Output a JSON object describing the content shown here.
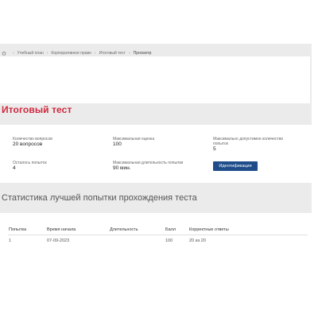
{
  "breadcrumb": {
    "home_icon": "home-icon",
    "items": [
      "Учебный план",
      "Корпоративное право",
      "Итоговый тест",
      "Просмотр"
    ]
  },
  "page_title": "Итоговый тест",
  "info": {
    "questions_count_label": "Количество вопросов",
    "questions_count_value": "20 вопросов",
    "max_score_label": "Максимальная оценка",
    "max_score_value": "100",
    "max_attempts_label": "Максимально допустимое количество попыток",
    "max_attempts_value": "5",
    "attempts_left_label": "Осталось попыток",
    "attempts_left_value": "4",
    "max_duration_label": "Максимальная длительность попытки",
    "max_duration_value": "90 мин.",
    "identify_button": "Идентификация"
  },
  "stats_title": "Статистика лучшей попытки прохождения теста",
  "table": {
    "headers": [
      "Попытка",
      "Время начала",
      "Длительность",
      "Балл",
      "Корректные ответы"
    ],
    "rows": [
      [
        "1",
        "07-09-2023",
        "",
        "100",
        "20 из 20"
      ]
    ]
  },
  "colors": {
    "title": "#d0283e",
    "button": "#1f4d8a",
    "background": "#ebebeb"
  }
}
